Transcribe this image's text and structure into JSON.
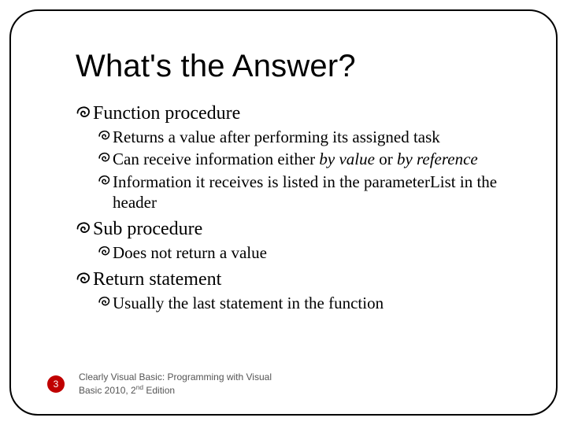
{
  "title": "What's the Answer?",
  "outline": [
    {
      "text": "Function procedure",
      "children": [
        {
          "text": "Returns a value after performing its assigned task"
        },
        {
          "html": "Can receive information either <span class=\"italic\">by value</span> or <span class=\"italic\">by reference</span>"
        },
        {
          "text": "Information it receives is listed in the parameterList in the header"
        }
      ]
    },
    {
      "text": "Sub procedure",
      "children": [
        {
          "text": "Does not return a value"
        }
      ]
    },
    {
      "text": "Return statement",
      "children": [
        {
          "text": "Usually the last statement in the function"
        }
      ]
    }
  ],
  "footer": {
    "page": "3",
    "line1": "Clearly Visual Basic: Programming with Visual",
    "line2_html": "Basic 2010, 2<span class=\"sup\">nd</span> Edition"
  }
}
